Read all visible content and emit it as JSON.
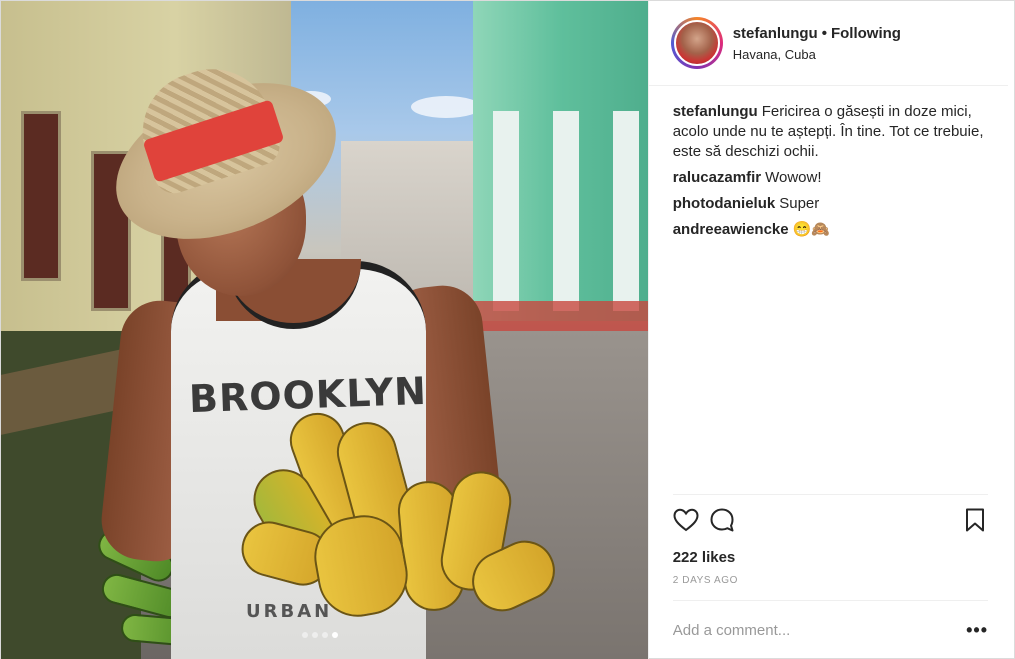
{
  "post": {
    "username": "stefanlungu",
    "separator": "•",
    "follow_status": "Following",
    "location": "Havana, Cuba",
    "likes": "222 likes",
    "date": "2 DAYS AGO",
    "carousel": {
      "count": 4,
      "active_index": 3
    }
  },
  "photo": {
    "shirt_text": "BROOKLYN",
    "shirt_text_bottom": "URBAN"
  },
  "comments": [
    {
      "user": "stefanlungu",
      "text": "Fericirea o găsești in doze mici, acolo unde nu te aștepți. În tine. Tot ce trebuie, este să deschizi ochii."
    },
    {
      "user": "ralucazamfir",
      "text": "Wowow!"
    },
    {
      "user": "photodanieluk",
      "text": "Super"
    },
    {
      "user": "andreeawiencke",
      "text": "😁🙈"
    }
  ],
  "add_comment": {
    "placeholder": "Add a comment...",
    "more_label": "•••"
  },
  "icons": [
    "heart-icon",
    "comment-icon",
    "bookmark-icon",
    "more-icon"
  ]
}
